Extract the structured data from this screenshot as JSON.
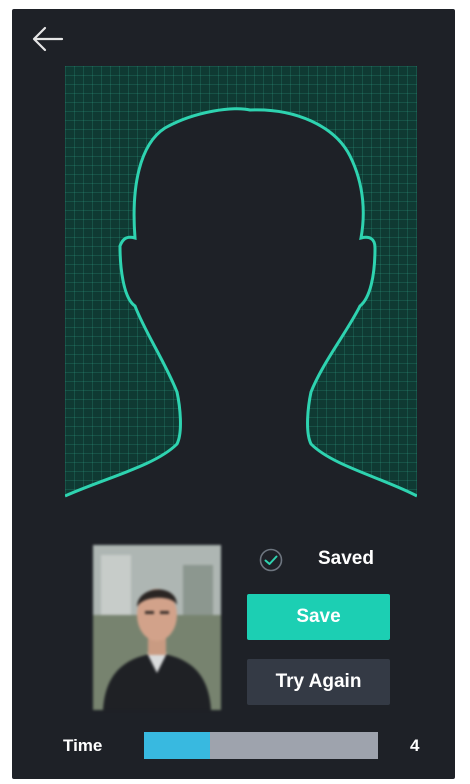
{
  "header": {
    "back_icon": "back-arrow-icon"
  },
  "capture": {
    "overlay_icon": "head-silhouette-guide",
    "accent_color": "#2ed3b0"
  },
  "status": {
    "icon": "check-circle-icon",
    "label": "Saved"
  },
  "actions": {
    "save_label": "Save",
    "try_again_label": "Try Again"
  },
  "timer": {
    "label": "Time",
    "value": "4",
    "progress_fraction": 0.28
  },
  "colors": {
    "background": "#1e2127",
    "save": "#1ccfb3",
    "secondary": "#343a45",
    "progress": "#38b9e0"
  }
}
